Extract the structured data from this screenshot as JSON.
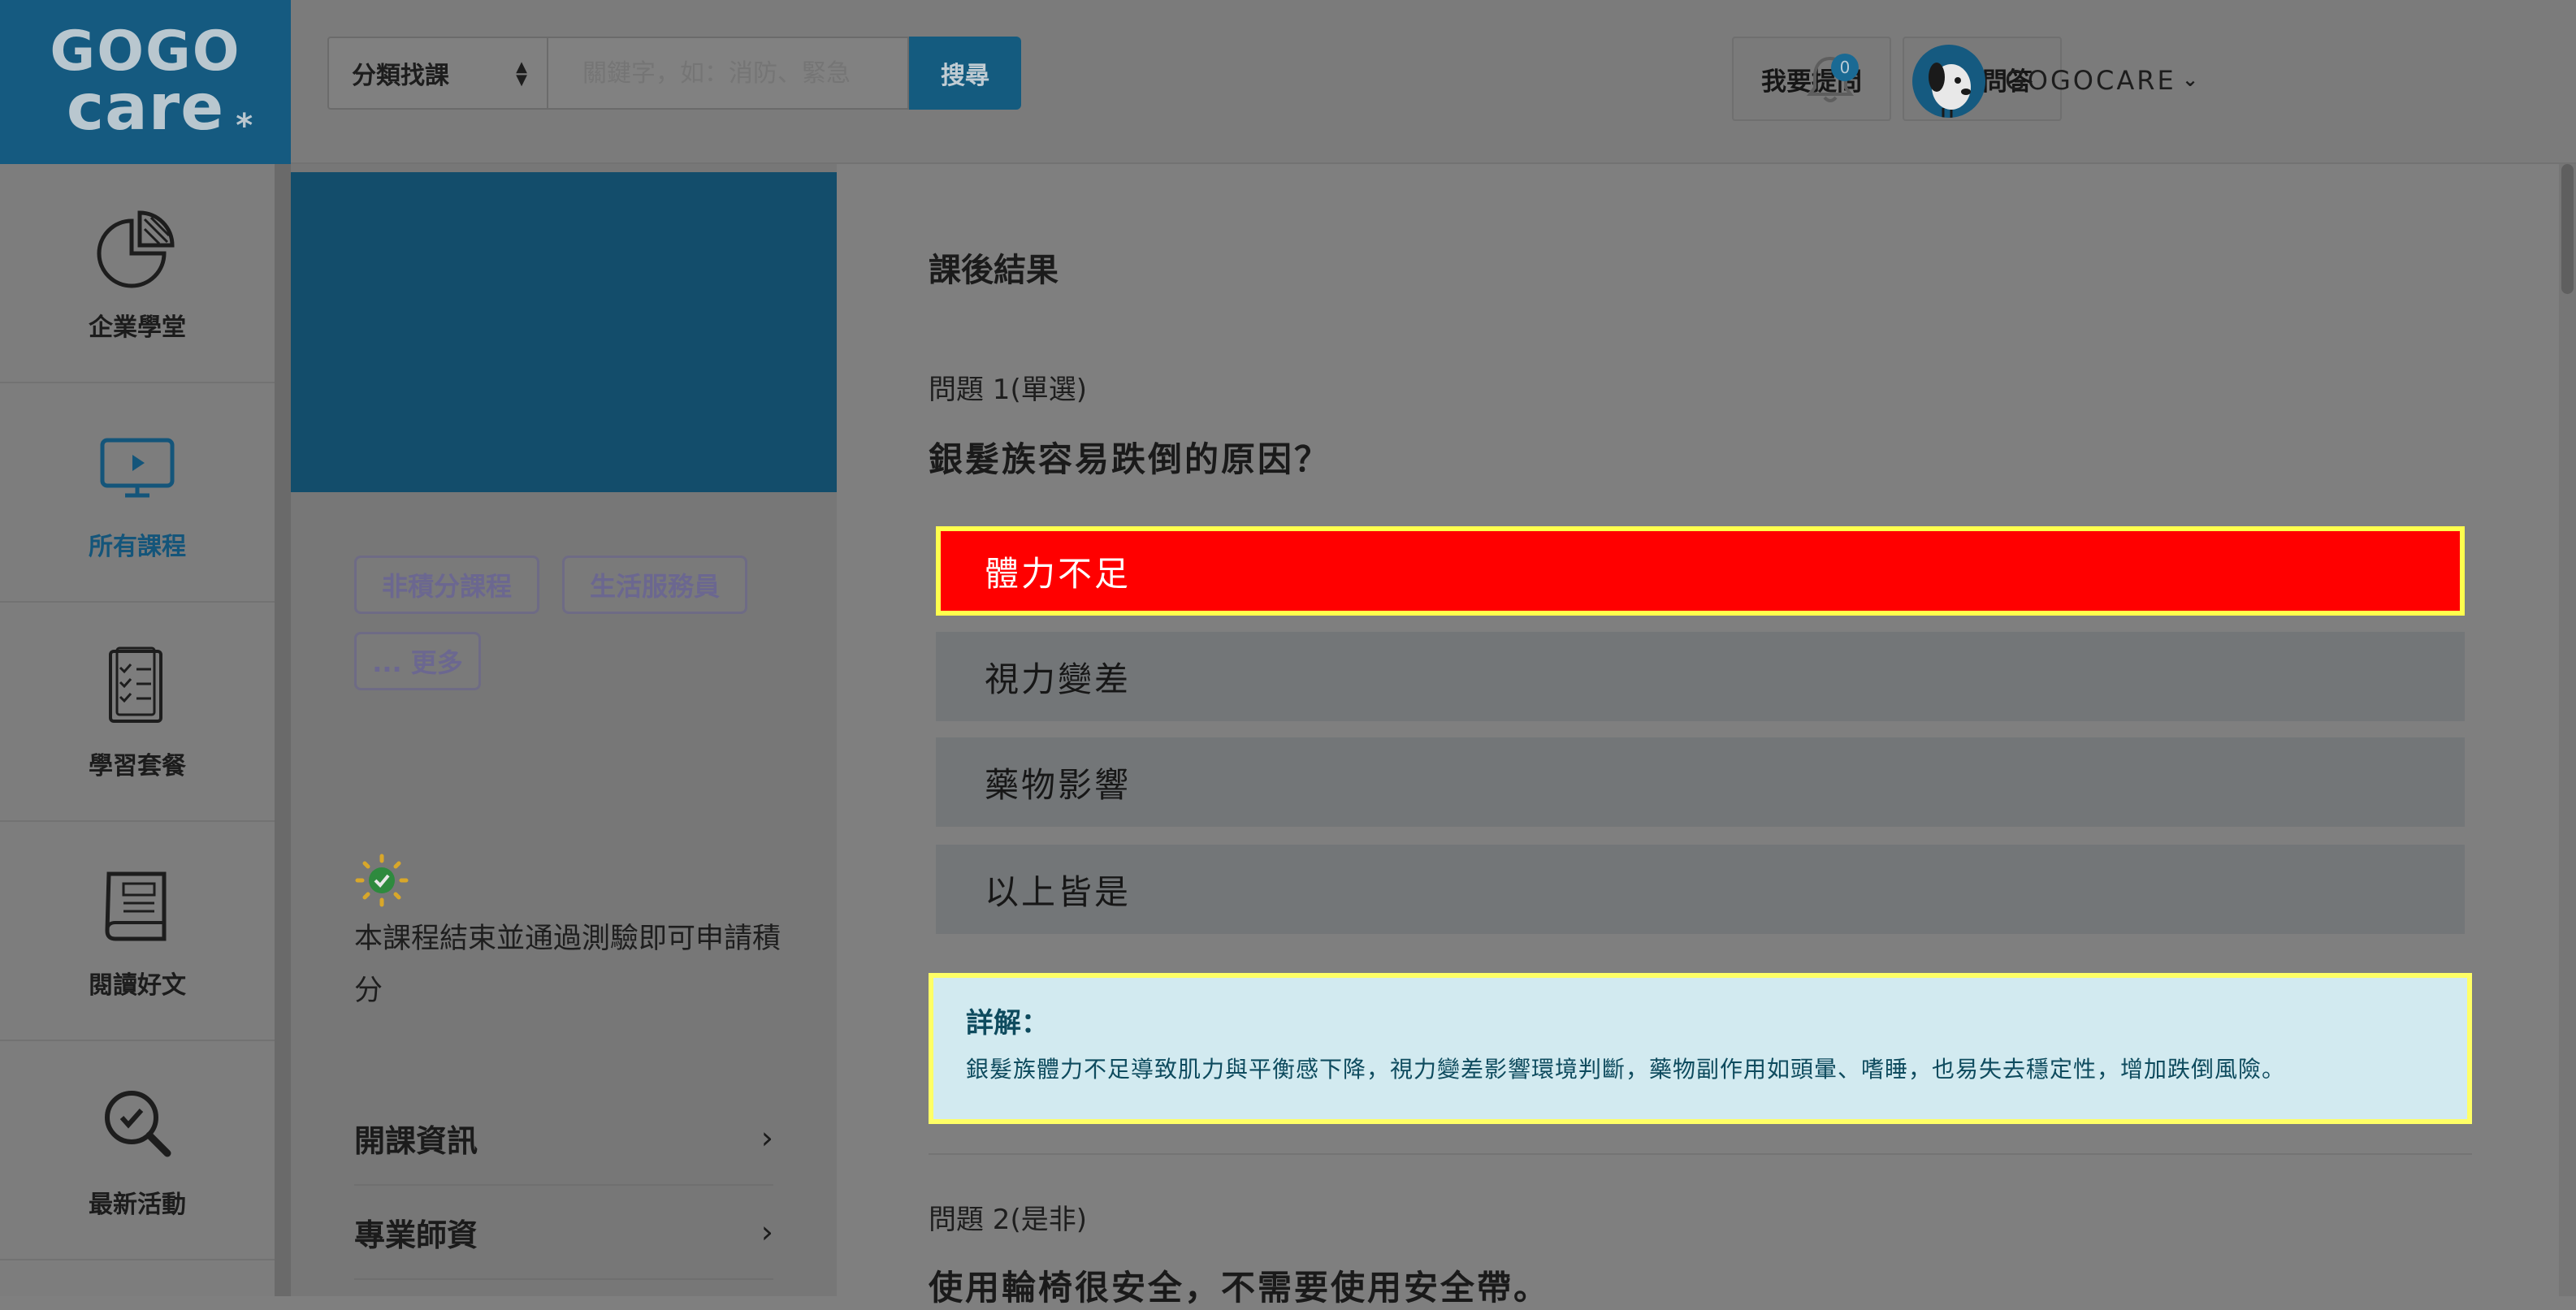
{
  "logo": {
    "line1": "GOGO",
    "line2": "care",
    "star": "*"
  },
  "header": {
    "category_select": "分類找課",
    "search_placeholder": "關鍵字，如：消防、緊急",
    "search_button": "搜尋",
    "ask_button": "我要提問",
    "faq_button": "常見問答",
    "notification_count": "0",
    "user_name": "GOGOCARE"
  },
  "leftnav": {
    "items": [
      {
        "label": "企業學堂",
        "icon": "pie-chart-icon"
      },
      {
        "label": "所有課程",
        "icon": "monitor-play-icon",
        "active": true
      },
      {
        "label": "學習套餐",
        "icon": "checklist-icon"
      },
      {
        "label": "閱讀好文",
        "icon": "book-icon"
      },
      {
        "label": "最新活動",
        "icon": "search-check-icon"
      }
    ]
  },
  "course": {
    "tags": [
      "非積分課程",
      "生活服務員",
      "... 更多"
    ],
    "credit_note": "本課程結束並通過測驗即可申請積分",
    "sections": [
      "開課資訊",
      "專業師資"
    ]
  },
  "main": {
    "heading": "課後結果",
    "q1": {
      "label": "問題 1(單選)",
      "text": "銀髮族容易跌倒的原因？",
      "options": [
        "體力不足",
        "視力變差",
        "藥物影響",
        "以上皆是"
      ],
      "selected_index": 0,
      "explanation_title": "詳解：",
      "explanation": "銀髮族體力不足導致肌力與平衡感下降，視力變差影響環境判斷，藥物副作用如頭暈、嗜睡，也易失去穩定性，增加跌倒風險。"
    },
    "q2": {
      "label": "問題 2(是非)",
      "text": "使用輪椅很安全，不需要使用安全帶。"
    }
  },
  "colors": {
    "brand": "#155a80",
    "selected_option": "#ff0000",
    "highlight_border": "#ffff4d",
    "explanation_bg": "#d2eaf0"
  }
}
